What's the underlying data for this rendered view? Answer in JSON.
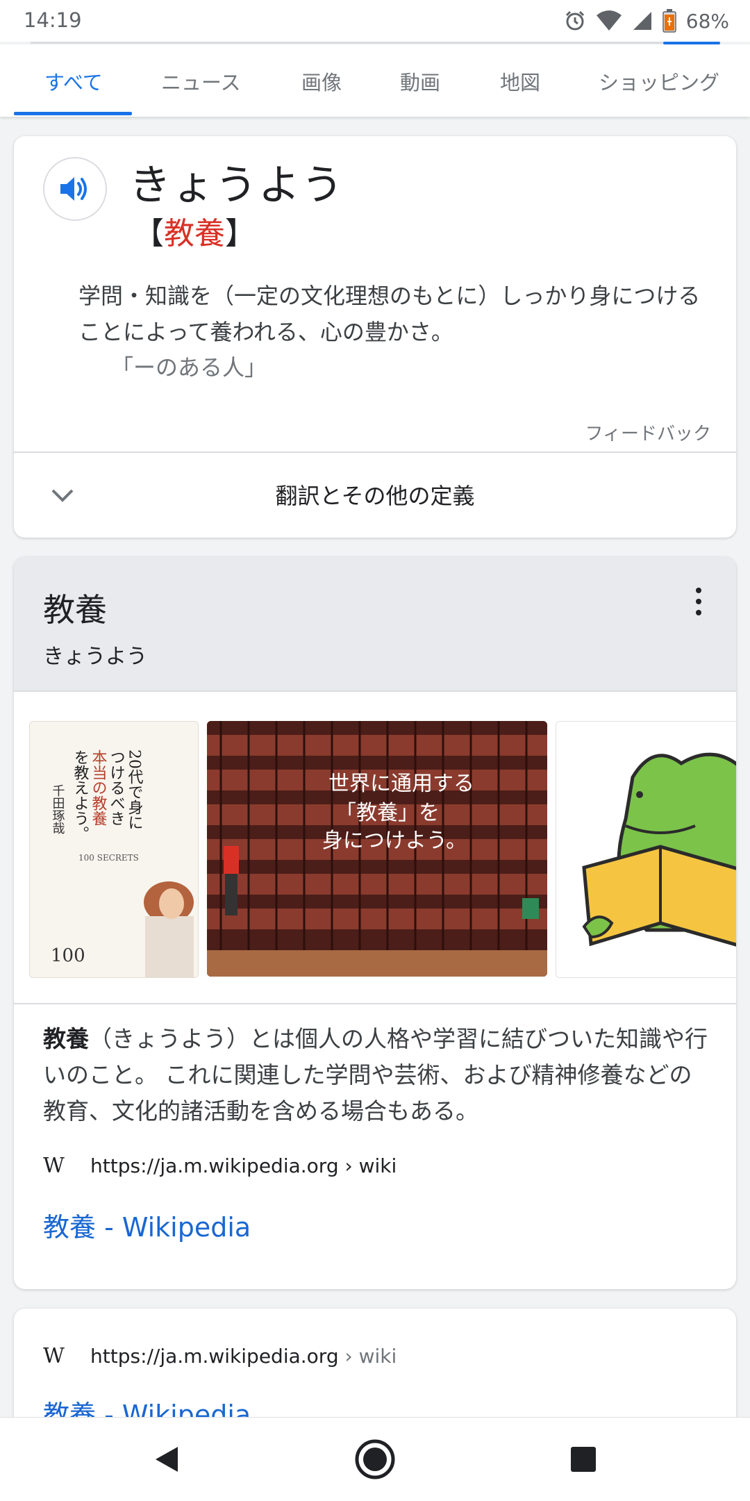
{
  "status_bar": {
    "time": "14:19",
    "battery": "68%",
    "icons": [
      "alarm-icon",
      "wifi-icon",
      "signal-icon",
      "battery-icon"
    ]
  },
  "tabs": [
    {
      "label": "すべて",
      "active": true
    },
    {
      "label": "ニュース",
      "active": false
    },
    {
      "label": "画像",
      "active": false
    },
    {
      "label": "動画",
      "active": false
    },
    {
      "label": "地図",
      "active": false
    },
    {
      "label": "ショッピング",
      "active": false
    }
  ],
  "dictionary": {
    "reading": "きょうよう",
    "bracket_open": "【",
    "kanji": "教養",
    "bracket_close": "】",
    "definition": "学問・知識を（一定の文化理想のもとに）しっかり身につけることによって養われる、心の豊かさ。",
    "example": "「ーのある人」",
    "feedback": "フィードバック",
    "more_label": "翻訳とその他の定義"
  },
  "knowledge_panel": {
    "title": "教養",
    "subtitle": "きょうよう",
    "images": [
      {
        "name": "book-cover-image",
        "caption": "20代で身につけるべき「本当の教養」を教えよう。"
      },
      {
        "name": "library-shelves-image",
        "caption": "世界に通用する「教養」を身につけよう。"
      },
      {
        "name": "frog-reading-image",
        "caption": ""
      }
    ],
    "description_bold": "教養",
    "description_rest": "（きょうよう）とは個人の人格や学習に結びついた知識や行いのこと。 これに関連した学問や芸術、および精神修養などの教育、文化的諸活動を含める場合もある。",
    "source_logo": "W",
    "source_url": "https://ja.m.wikipedia.org › wiki",
    "link_title": "教養 - Wikipedia"
  },
  "result": {
    "source_logo": "W",
    "source_domain": "https://ja.m.wikipedia.org",
    "source_path": " › wiki",
    "link_title": "教養 - Wikipedia"
  },
  "colors": {
    "accent": "#1a73e8",
    "link": "#1967d2",
    "highlight": "#d93025"
  }
}
